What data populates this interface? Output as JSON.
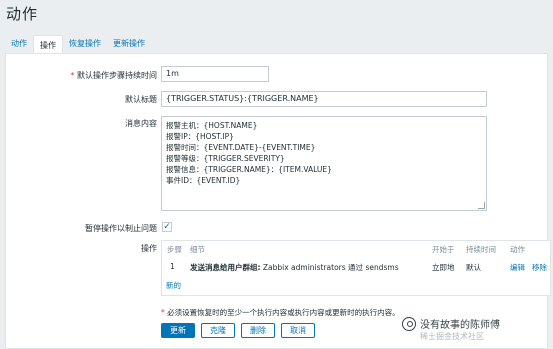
{
  "page": {
    "title": "动作"
  },
  "tabs": [
    {
      "label": "动作",
      "active": false
    },
    {
      "label": "操作",
      "active": true
    },
    {
      "label": "恢复操作",
      "active": false
    },
    {
      "label": "更新操作",
      "active": false
    }
  ],
  "form": {
    "default_step_duration": {
      "label": "默认操作步骤持续时间",
      "value": "1m"
    },
    "default_subject": {
      "label": "默认标题",
      "value": "{TRIGGER.STATUS}:{TRIGGER.NAME}"
    },
    "message": {
      "label": "消息内容",
      "lines": [
        "报警主机：{HOST.NAME}",
        "报警IP：{HOST.IP}",
        "报警时间：{EVENT.DATE}-{EVENT.TIME}",
        "报警等级：{TRIGGER.SEVERITY}",
        "报警信息：{TRIGGER.NAME}：{ITEM.VALUE}",
        "事件ID：{EVENT.ID}"
      ]
    },
    "pause": {
      "label": "暂停操作以制止问题",
      "checked": true,
      "check_glyph": "✓"
    }
  },
  "operations": {
    "label": "操作",
    "headers": {
      "step": "步骤",
      "details": "细节",
      "start_in": "开始于",
      "duration": "持续时间",
      "action": "动作"
    },
    "rows": [
      {
        "step": "1",
        "details_bold": "发送消息给用户群组:",
        "details_rest": " Zabbix administrators 通过 sendsms",
        "start_in": "立即地",
        "duration": "默认",
        "edit": "编辑",
        "remove": "移除"
      }
    ],
    "new_link": "新的"
  },
  "note": "必须设置恢复时的至少一个执行内容或执行内容或更新时的执行内容。",
  "buttons": {
    "update": "更新",
    "clone": "克隆",
    "delete": "删除",
    "cancel": "取消"
  },
  "watermark": {
    "text": "没有故事的陈师傅",
    "sub": "稀土掘金技术社区",
    "icon": "wechat-channel-icon"
  },
  "colors": {
    "link": "#0275b8",
    "required": "#e33734",
    "background": "#ebeef0"
  }
}
